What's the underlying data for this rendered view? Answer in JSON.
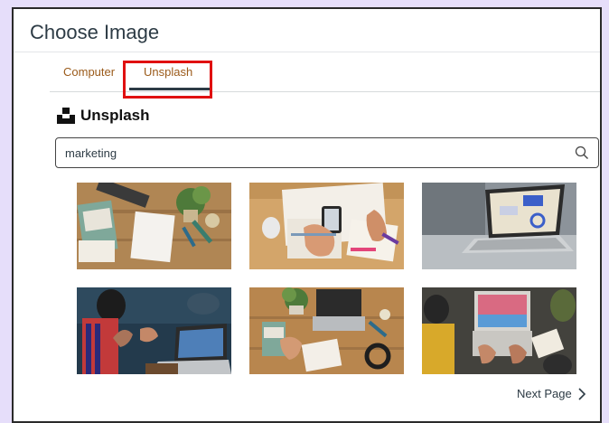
{
  "dialog": {
    "title": "Choose Image"
  },
  "tabs": [
    {
      "label": "Computer",
      "active": false
    },
    {
      "label": "Unsplash",
      "active": true
    }
  ],
  "brand": {
    "name": "Unsplash",
    "logo_icon": "unsplash-logo-icon"
  },
  "search": {
    "value": "marketing",
    "icon": "search-icon"
  },
  "results": [
    {
      "id": "img1",
      "description": "marketing strategy book and plants on wooden desk"
    },
    {
      "id": "img2",
      "description": "hands with phone and charts on desk"
    },
    {
      "id": "img3",
      "description": "laptop with analytics dashboard"
    },
    {
      "id": "img4",
      "description": "people in meeting with laptop"
    },
    {
      "id": "img5",
      "description": "desk with laptop and marketing book top view"
    },
    {
      "id": "img6",
      "description": "team working on laptop top view"
    }
  ],
  "pagination": {
    "next_label": "Next Page",
    "icon": "chevron-right-icon"
  },
  "colors": {
    "tab_text": "#9b5b1b",
    "highlight": "#e01010",
    "page_bg": "#e6defa"
  }
}
